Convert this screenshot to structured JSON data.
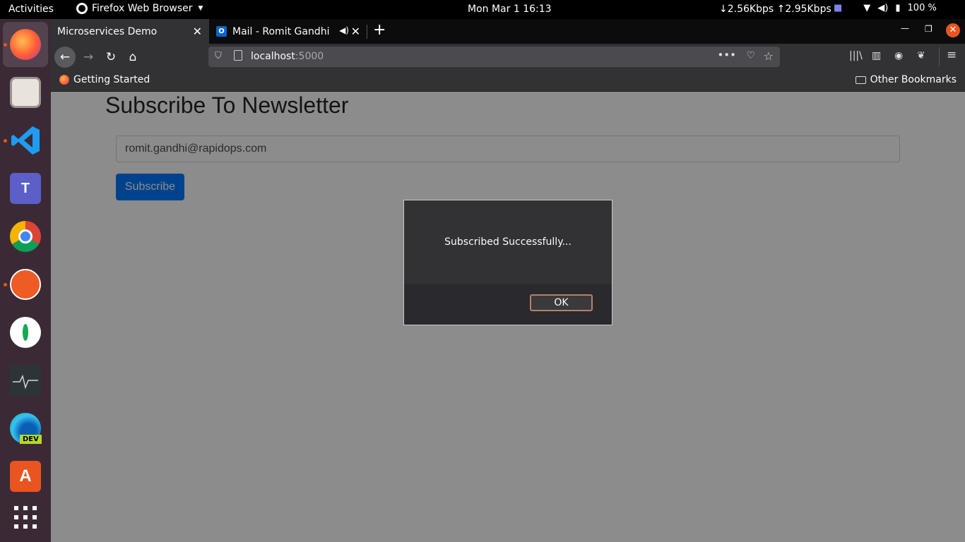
{
  "system": {
    "activities": "Activities",
    "app_name": "Firefox Web Browser",
    "clock": "Mon Mar 1  16:13",
    "net_speed": "↓2.56Kbps ↑2.95Kbps",
    "battery": "100 %"
  },
  "dock": {
    "apps": [
      "firefox-icon",
      "files-icon",
      "vscode-icon",
      "teams-icon",
      "chrome-icon",
      "postman-icon",
      "mongodb-compass-icon",
      "system-monitor-icon",
      "edge-dev-icon",
      "software-center-icon",
      "show-apps-icon"
    ],
    "edge_badge": "DEV"
  },
  "browser": {
    "tabs": [
      {
        "title": "Microservices Demo"
      },
      {
        "title": "Mail - Romit Gandhi - "
      }
    ],
    "url_host": "localhost",
    "url_port": ":5000",
    "bookmarks": {
      "getting_started": "Getting Started",
      "other": "Other Bookmarks"
    }
  },
  "page": {
    "title": "Subscribe To Newsletter",
    "email_value": "romit.gandhi@rapidops.com",
    "subscribe_label": "Subscribe"
  },
  "dialog": {
    "message": "Subscribed Successfully...",
    "ok_label": "OK"
  },
  "colors": {
    "primary": "#007bff",
    "ubuntu_orange": "#e95420"
  }
}
